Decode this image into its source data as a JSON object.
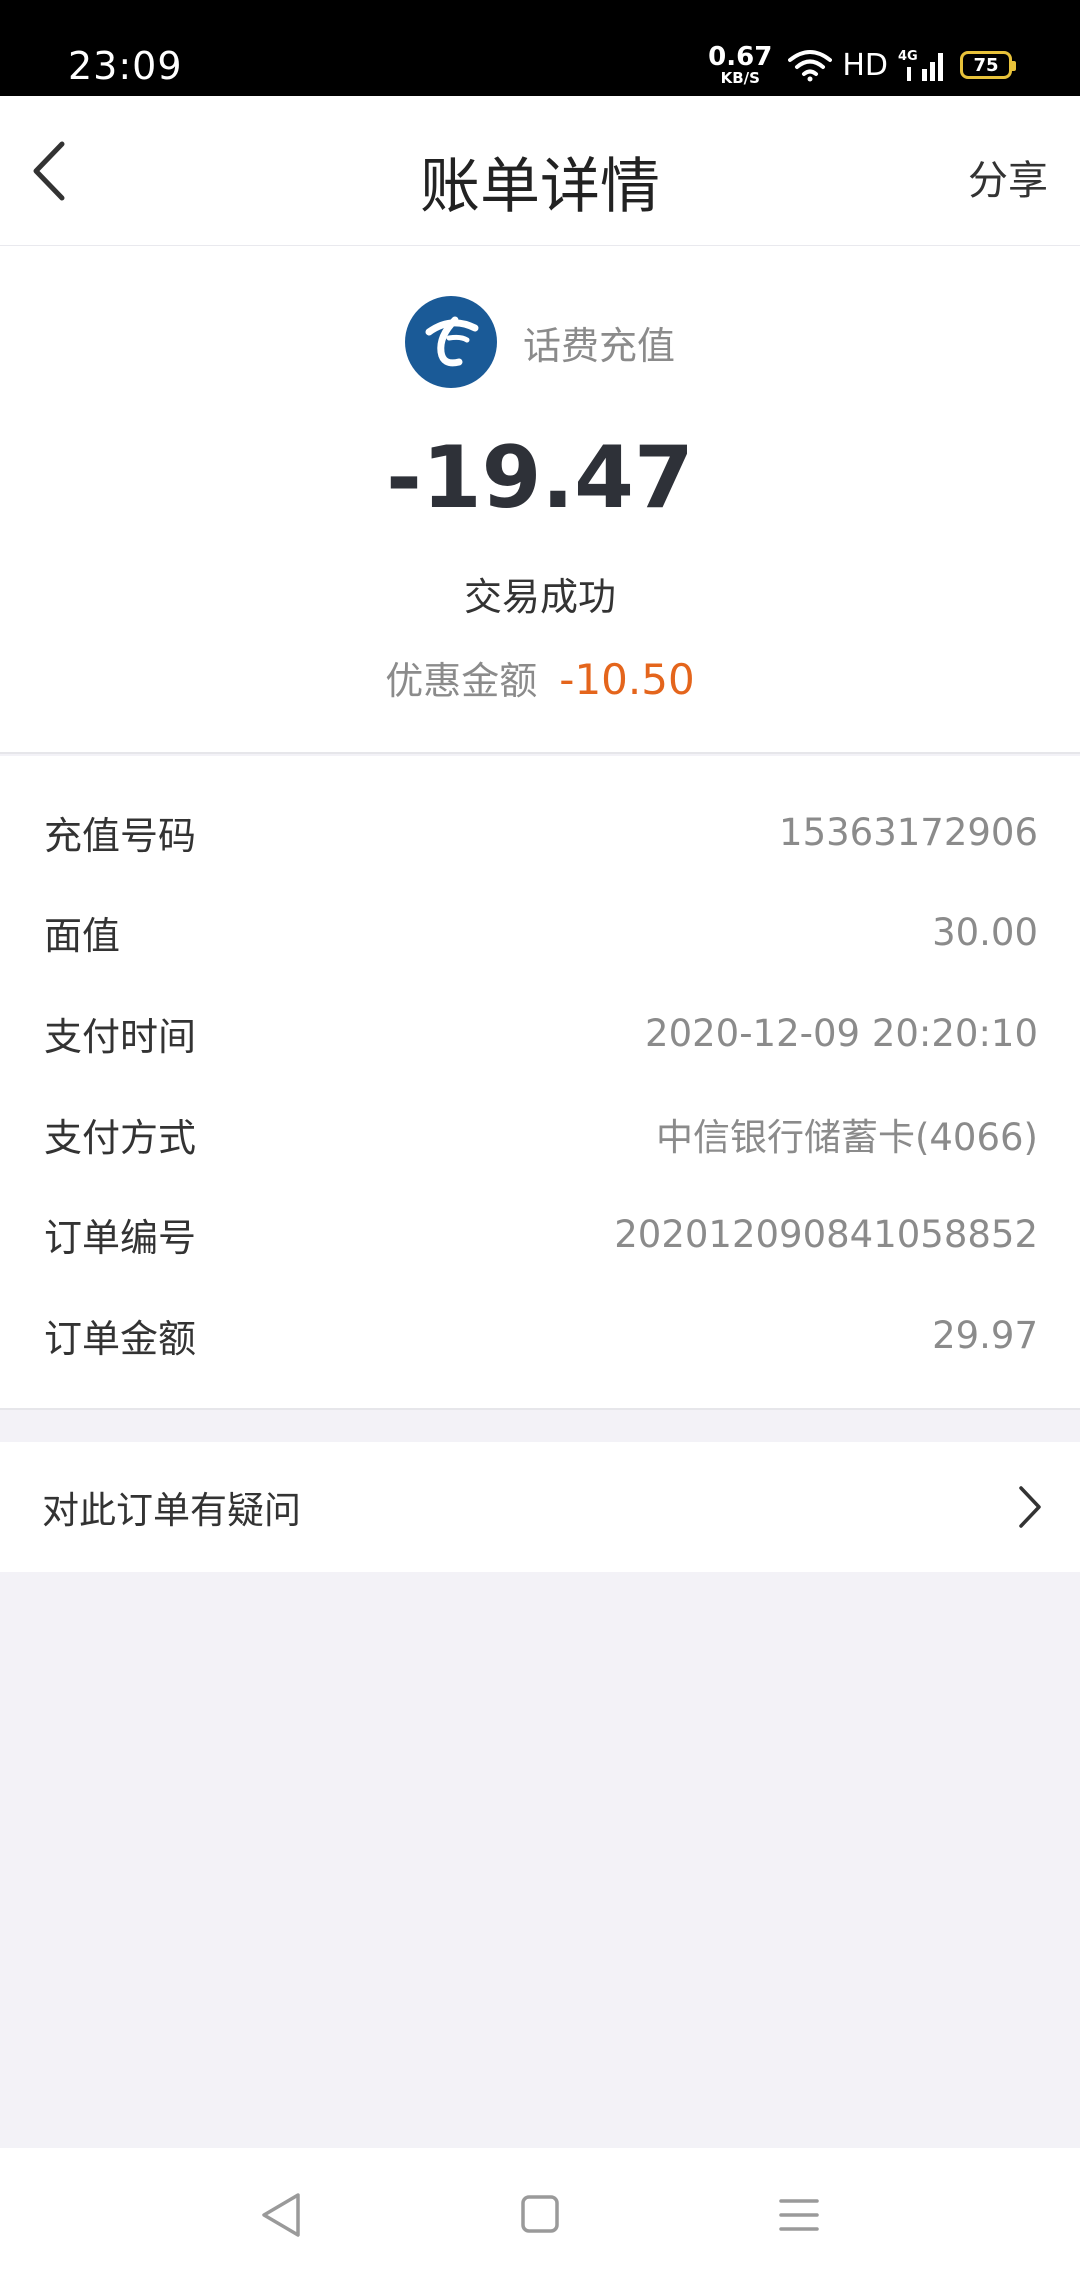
{
  "status_bar": {
    "time": "23:09",
    "net_speed_value": "0.67",
    "net_speed_unit": "KB/S",
    "hd": "HD",
    "network": "4G",
    "battery_level": "75"
  },
  "header": {
    "title": "账单详情",
    "share_label": "分享"
  },
  "summary": {
    "merchant_name": "话费充值",
    "amount": "-19.47",
    "status": "交易成功",
    "discount_label": "优惠金额",
    "discount_value": "-10.50"
  },
  "details": [
    {
      "label": "充值号码",
      "value": "15363172906"
    },
    {
      "label": "面值",
      "value": "30.00"
    },
    {
      "label": "支付时间",
      "value": "2020-12-09 20:20:10"
    },
    {
      "label": "支付方式",
      "value": "中信银行储蓄卡(4066)"
    },
    {
      "label": "订单编号",
      "value": "202012090841058852"
    },
    {
      "label": "订单金额",
      "value": "29.97"
    }
  ],
  "question": {
    "label": "对此订单有疑问"
  },
  "colors": {
    "accent_orange": "#e4651c",
    "logo_blue": "#1a5a97",
    "page_bg": "#f3f2f7"
  }
}
